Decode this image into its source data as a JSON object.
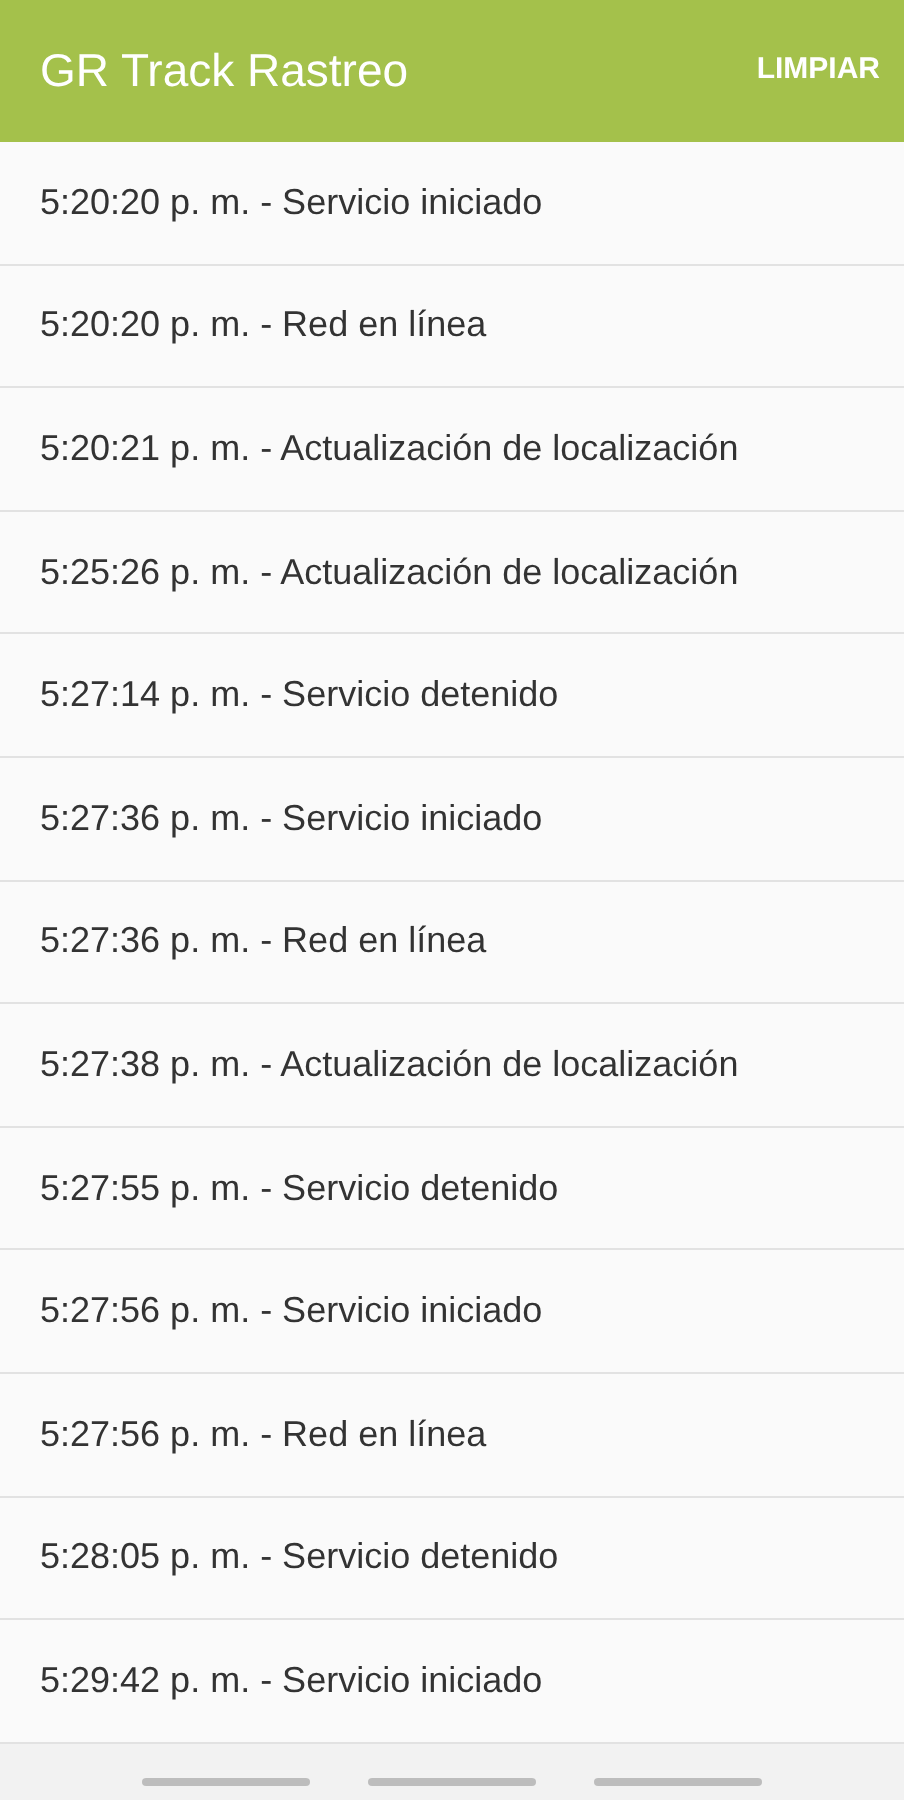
{
  "app_bar": {
    "title": "GR Track Rastreo",
    "action": "LIMPIAR"
  },
  "log_entries": [
    "5:20:20 p. m. - Servicio iniciado",
    "5:20:20 p. m. - Red en línea",
    "5:20:21 p. m. - Actualización de localización",
    "5:25:26 p. m. - Actualización de localización",
    "5:27:14 p. m. - Servicio detenido",
    "5:27:36 p. m. - Servicio iniciado",
    "5:27:36 p. m. - Red en línea",
    "5:27:38 p. m. - Actualización de localización",
    "5:27:55 p. m. - Servicio detenido",
    "5:27:56 p. m. - Servicio iniciado",
    "5:27:56 p. m. - Red en línea",
    "5:28:05 p. m. - Servicio detenido",
    "5:29:42 p. m. - Servicio iniciado"
  ]
}
